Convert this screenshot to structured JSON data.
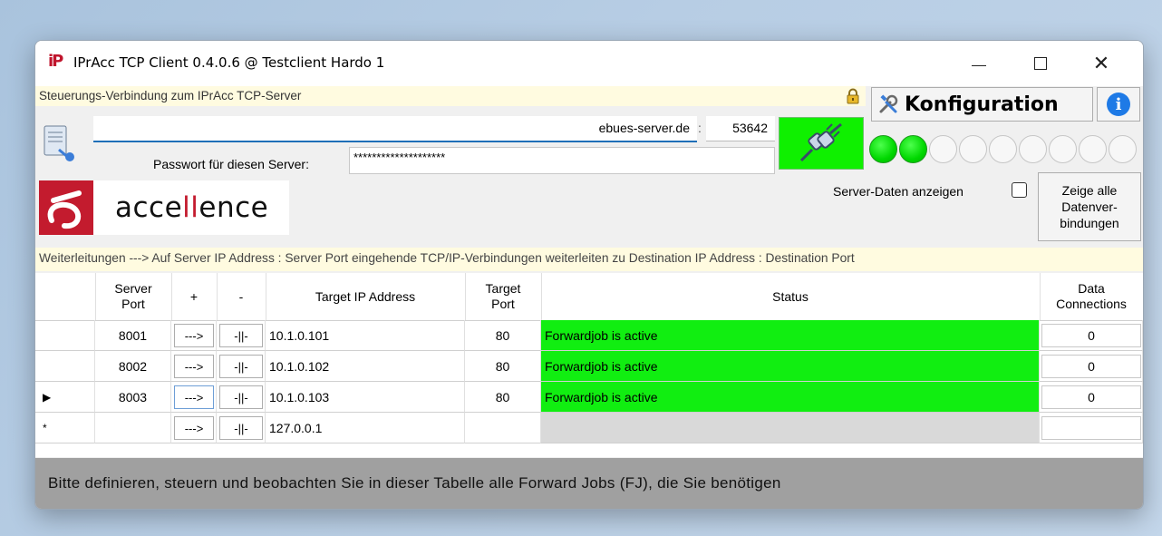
{
  "window": {
    "title": "IPrAcc TCP Client 0.4.0.6 @ Testclient Hardo 1",
    "app_icon_text": "iP"
  },
  "connection": {
    "label": "Steuerungs-Verbindung zum IPrAcc TCP-Server",
    "server_host": "ebues-server.de",
    "separator": ":",
    "server_port": "53642",
    "password_label": "Passwort für diesen Server:",
    "password_value": "********************",
    "connected": true
  },
  "toolbar": {
    "konfig_label": "Konfiguration"
  },
  "status_leds": [
    true,
    true,
    false,
    false,
    false,
    false,
    false,
    false,
    false
  ],
  "logo": {
    "text_pre": "acce",
    "text_mid": "ll",
    "text_post": "ence",
    "color": "#c31b2e"
  },
  "options": {
    "show_server_label": "Server-Daten anzeigen",
    "show_server_checked": false,
    "show_all_label_1": "Zeige alle",
    "show_all_label_2": "Datenver-",
    "show_all_label_3": "bindungen"
  },
  "forward_info": "Weiterleitungen  ---> Auf   Server IP Address : Server Port   eingehende TCP/IP-Verbindungen weiterleiten zu   Destination IP Address : Destination Port",
  "grid": {
    "headers": {
      "server_port_1": "Server",
      "server_port_2": "Port",
      "plus": "+",
      "minus": "-",
      "target_ip": "Target IP Address",
      "target_port_1": "Target",
      "target_port_2": "Port",
      "status": "Status",
      "data_conn_1": "Data",
      "data_conn_2": "Connections"
    },
    "rows": [
      {
        "marker": "",
        "server_port": "8001",
        "plus_btn": "--->",
        "minus_btn": "-||-",
        "target_ip": "10.1.0.101",
        "target_port": "80",
        "status": "Forwardjob is active",
        "data_connections": "0"
      },
      {
        "marker": "",
        "server_port": "8002",
        "plus_btn": "--->",
        "minus_btn": "-||-",
        "target_ip": "10.1.0.102",
        "target_port": "80",
        "status": "Forwardjob is active",
        "data_connections": "0"
      },
      {
        "marker": "▶",
        "server_port": "8003",
        "plus_btn": "--->",
        "minus_btn": "-||-",
        "target_ip": "10.1.0.103",
        "target_port": "80",
        "status": "Forwardjob is active",
        "data_connections": "0"
      },
      {
        "marker": "*",
        "server_port": "",
        "plus_btn": "--->",
        "minus_btn": "-||-",
        "target_ip": "127.0.0.1",
        "target_port": "",
        "status": "",
        "data_connections": ""
      }
    ],
    "status_active_color": "#11ee11"
  },
  "footer": {
    "hint": "Bitte definieren, steuern und beobachten Sie in dieser Tabelle alle Forward Jobs (FJ), die Sie benötigen"
  }
}
